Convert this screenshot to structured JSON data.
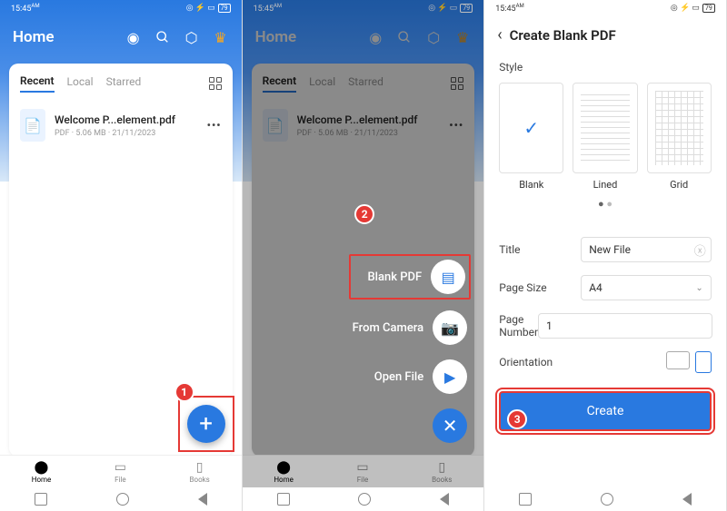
{
  "status": {
    "time": "15:45",
    "am": "AM",
    "bat": "79"
  },
  "home": {
    "title": "Home",
    "tabs": {
      "recent": "Recent",
      "local": "Local",
      "starred": "Starred"
    },
    "file": {
      "name": "Welcome P...element.pdf",
      "meta": "PDF · 5.06 MB · 21/11/2023"
    },
    "nav": {
      "home": "Home",
      "file": "File",
      "books": "Books"
    }
  },
  "menu": {
    "blank": "Blank PDF",
    "camera": "From Camera",
    "open": "Open File"
  },
  "create": {
    "title": "Create Blank PDF",
    "style_label": "Style",
    "blank": "Blank",
    "lined": "Lined",
    "grid": "Grid",
    "title_label": "Title",
    "title_value": "New File",
    "pagesize_label": "Page Size",
    "pagesize_value": "A4",
    "pagenum_label": "Page Number",
    "pagenum_value": "1",
    "orient_label": "Orientation",
    "create_btn": "Create"
  },
  "badges": {
    "b1": "1",
    "b2": "2",
    "b3": "3"
  }
}
